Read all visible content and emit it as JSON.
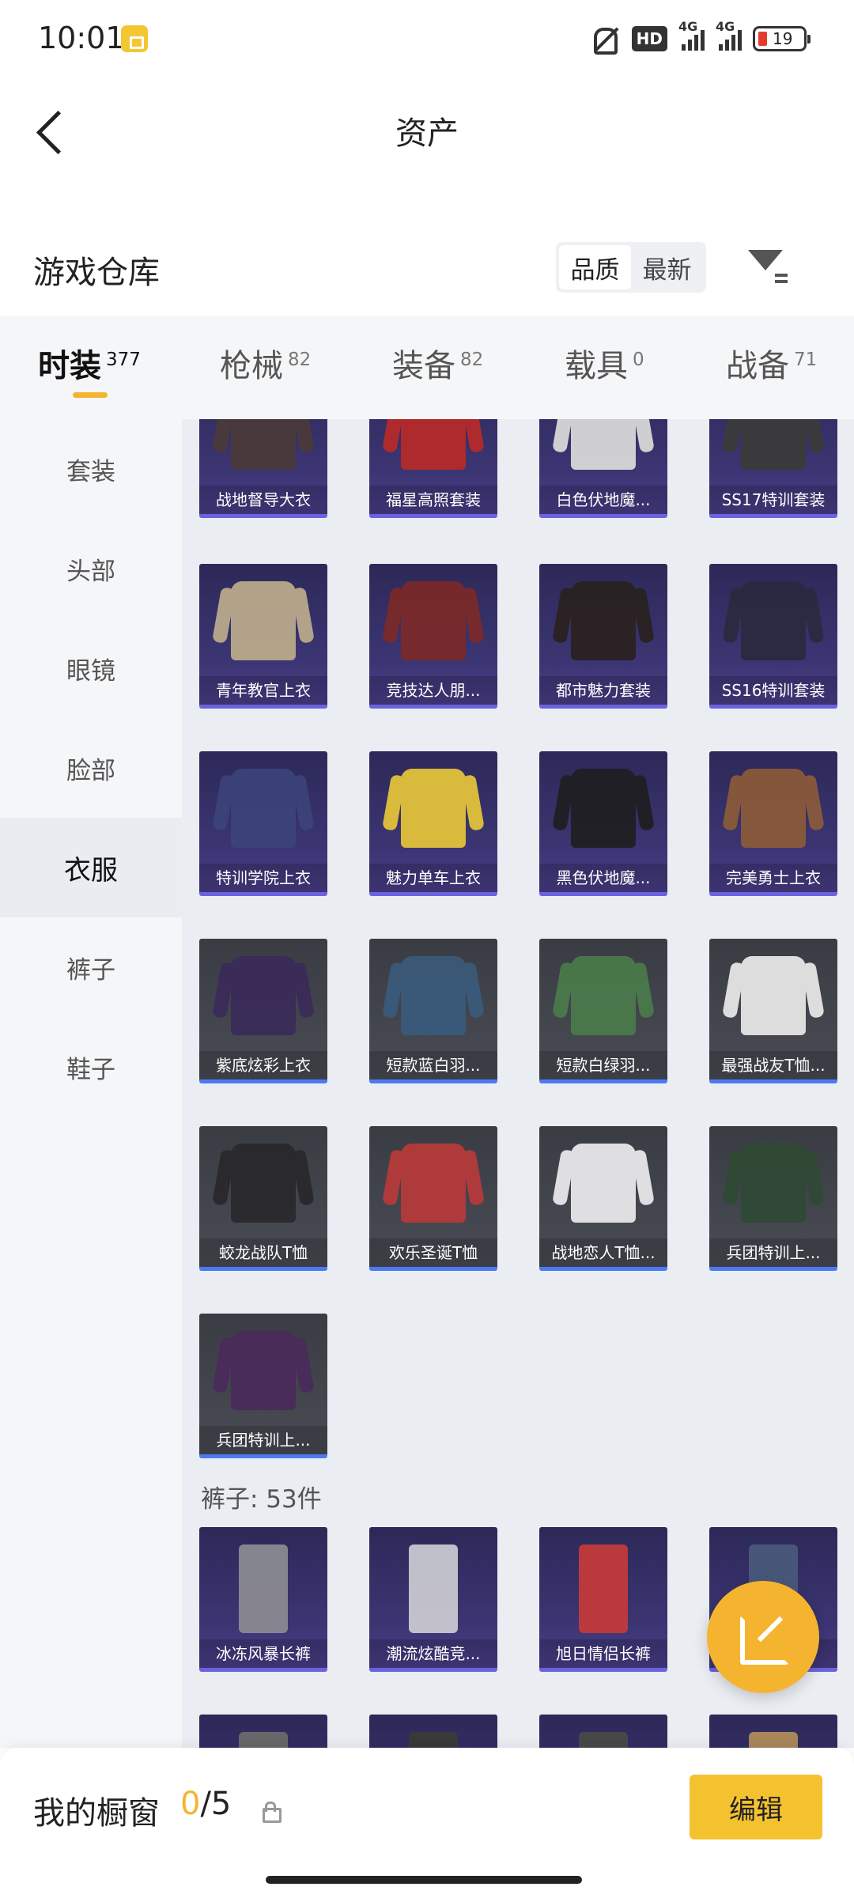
{
  "status_bar": {
    "time": "10:01",
    "hd": "HD",
    "net1": "4G",
    "net2": "4G",
    "battery": "19"
  },
  "header": {
    "title": "资产"
  },
  "warehouse": {
    "title": "游戏仓库",
    "sort": [
      "品质",
      "最新"
    ],
    "active_sort": 0
  },
  "tabs": [
    {
      "label": "时装",
      "count": "377"
    },
    {
      "label": "枪械",
      "count": "82"
    },
    {
      "label": "装备",
      "count": "82"
    },
    {
      "label": "载具",
      "count": "0"
    },
    {
      "label": "战备",
      "count": "71"
    }
  ],
  "sidebar": [
    "套装",
    "头部",
    "眼镜",
    "脸部",
    "衣服",
    "裤子",
    "鞋子"
  ],
  "clothes_rows": [
    [
      {
        "name": "战地督导大衣",
        "rarity": "purple",
        "color": "#4a3a3a"
      },
      {
        "name": "福星高照套装",
        "rarity": "purple",
        "color": "#b52a2a"
      },
      {
        "name": "白色伏地魔...",
        "rarity": "purple",
        "color": "#d8d8d8"
      },
      {
        "name": "SS17特训套装",
        "rarity": "purple",
        "color": "#3b3b3b"
      }
    ],
    [
      {
        "name": "青年教官上衣",
        "rarity": "purple",
        "color": "#b9a98b"
      },
      {
        "name": "竞技达人朋...",
        "rarity": "purple",
        "color": "#7a2a2a"
      },
      {
        "name": "都市魅力套装",
        "rarity": "purple",
        "color": "#2a2222"
      },
      {
        "name": "SS16特训套装",
        "rarity": "purple",
        "color": "#2c2a40"
      }
    ],
    [
      {
        "name": "特训学院上衣",
        "rarity": "purple",
        "color": "#3b4378"
      },
      {
        "name": "魅力单车上衣",
        "rarity": "purple",
        "color": "#e2c23a"
      },
      {
        "name": "黑色伏地魔...",
        "rarity": "purple",
        "color": "#1f1f22"
      },
      {
        "name": "完美勇士上衣",
        "rarity": "purple",
        "color": "#8a5a3a"
      }
    ],
    [
      {
        "name": "紫底炫彩上衣",
        "rarity": "gray",
        "color": "#3a2c58"
      },
      {
        "name": "短款蓝白羽...",
        "rarity": "gray",
        "color": "#3a5a7a"
      },
      {
        "name": "短款白绿羽...",
        "rarity": "gray",
        "color": "#4a7a4a"
      },
      {
        "name": "最强战友T恤...",
        "rarity": "gray",
        "color": "#e6e6e6"
      }
    ],
    [
      {
        "name": "蛟龙战队T恤",
        "rarity": "gray",
        "color": "#2a2a2c"
      },
      {
        "name": "欢乐圣诞T恤",
        "rarity": "gray",
        "color": "#b53a3a"
      },
      {
        "name": "战地恋人T恤...",
        "rarity": "gray",
        "color": "#e8e8ea"
      },
      {
        "name": "兵团特训上...",
        "rarity": "gray",
        "color": "#2f4a35"
      }
    ],
    [
      {
        "name": "兵团特训上...",
        "rarity": "gray",
        "color": "#4a2c5a"
      }
    ]
  ],
  "pants_section": {
    "label": "裤子: 53件"
  },
  "pants_row": [
    {
      "name": "冰冻风暴长裤",
      "rarity": "purple",
      "color": "#8a8a90"
    },
    {
      "name": "潮流炫酷竞...",
      "rarity": "purple",
      "color": "#c8c8d0"
    },
    {
      "name": "旭日情侣长裤",
      "rarity": "purple",
      "color": "#c23a3a"
    },
    {
      "name": "",
      "rarity": "purple",
      "color": "#4a5a7a"
    }
  ],
  "peek_row": [
    {
      "rarity": "purple",
      "color": "#6a6a6a"
    },
    {
      "rarity": "purple",
      "color": "#3a3a3a"
    },
    {
      "rarity": "purple",
      "color": "#4a4a4a"
    },
    {
      "rarity": "purple",
      "color": "#b08a5a"
    }
  ],
  "bottom_bar": {
    "label": "我的橱窗",
    "current": "0",
    "total": "/5",
    "edit": "编辑"
  },
  "colors": {
    "accent": "#f5b430",
    "purple_border": "#6b62e0",
    "blue_border": "#4e79f5"
  }
}
